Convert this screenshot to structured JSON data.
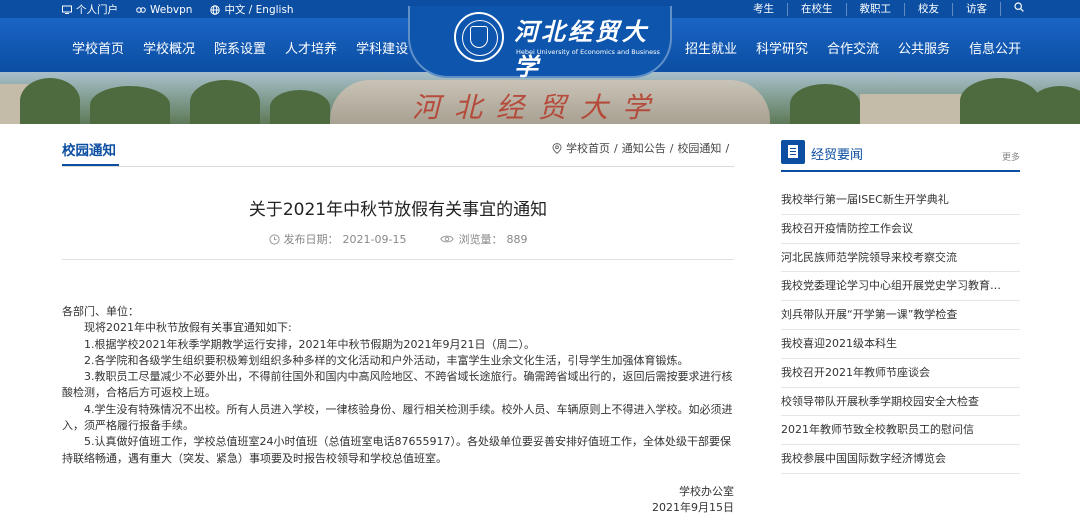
{
  "topbar": {
    "left_links": [
      {
        "label": "个人门户",
        "icon": "monitor-icon"
      },
      {
        "label": "Webvpn",
        "icon": "link-icon"
      },
      {
        "label": "中文 / English",
        "icon": "globe-icon"
      }
    ],
    "right_links": [
      "考生",
      "在校生",
      "教职工",
      "校友",
      "访客"
    ],
    "search_icon": "search-icon"
  },
  "nav": {
    "left": [
      "学校首页",
      "学校概况",
      "院系设置",
      "人才培养",
      "学科建设"
    ],
    "right": [
      "招生就业",
      "科学研究",
      "合作交流",
      "公共服务",
      "信息公开"
    ]
  },
  "logo": {
    "name_cn": "河北经贸大学",
    "name_en": "Hebei University of Economics and Business"
  },
  "banner": {
    "stone_text": "河北经贸大学"
  },
  "section": {
    "title": "校园通知",
    "breadcrumb": [
      "学校首页",
      "通知公告",
      "校园通知"
    ],
    "breadcrumb_sep": "/"
  },
  "article": {
    "title": "关于2021年中秋节放假有关事宜的通知",
    "date_label": "发布日期：",
    "date": "2021-09-15",
    "views_label": "浏览量：",
    "views": "889",
    "greeting": "各部门、单位：",
    "paragraphs": [
      "现将2021年中秋节放假有关事宜通知如下:",
      "1.根据学校2021年秋季学期教学运行安排，2021年中秋节假期为2021年9月21日（周二）。",
      "2.各学院和各级学生组织要积极筹划组织多种多样的文化活动和户外活动，丰富学生业余文化生活，引导学生加强体育锻炼。",
      "3.教职员工尽量减少不必要外出，不得前往国外和国内中高风险地区、不跨省域长途旅行。确需跨省域出行的，返回后需按要求进行核酸检测，合格后方可返校上班。",
      "4.学生没有特殊情况不出校。所有人员进入学校，一律核验身份、履行相关检测手续。校外人员、车辆原则上不得进入学校。如必须进入，须严格履行报备手续。",
      "5.认真做好值班工作，学校总值班室24小时值班（总值班室电话87655917）。各处级单位要妥善安排好值班工作，全体处级干部要保持联络畅通，遇有重大（突发、紧急）事项要及时报告校领导和学校总值班室。"
    ],
    "signature": "学校办公室",
    "sign_date": "2021年9月15日"
  },
  "sidebar": {
    "title": "经贸要闻",
    "more": "更多",
    "items": [
      "我校举行第一届ISEC新生开学典礼",
      "我校召开疫情防控工作会议",
      "河北民族师范学院领导来校考察交流",
      "我校党委理论学习中心组开展党史学习教育…",
      "刘兵带队开展“开学第一课”教学检查",
      "我校喜迎2021级本科生",
      "我校召开2021年教师节座谈会",
      "校领导带队开展秋季学期校园安全大检查",
      "2021年教师节致全校教职员工的慰问信",
      "我校参展中国国际数字经济博览会"
    ]
  },
  "colors": {
    "primary": "#0b4ea2",
    "nav_light": "#1a64c4"
  }
}
